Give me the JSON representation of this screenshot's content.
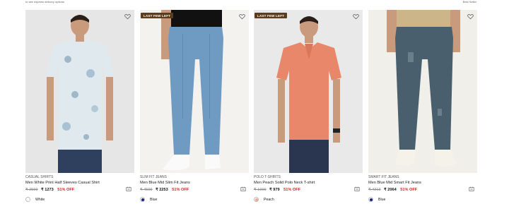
{
  "page": {
    "top_note": "to see express delivery options",
    "top_right": "Best Seller",
    "colors": {
      "discount": "#c62828",
      "badge": "#5a3d1e"
    }
  },
  "products": [
    {
      "badge": "",
      "category": "CASUAL SHIRTS",
      "name": "Men White Print Half Sleeves Casual Shirt",
      "mrp": "₹ 2599",
      "price": "₹ 1273",
      "discount": "51% OFF",
      "color_name": "White",
      "swatch": "#ffffff",
      "bg": "#e6e6e6",
      "top_color": "#dfe9ee",
      "bottom_color": "#2f3f5e"
    },
    {
      "badge": "LAST FEW LEFT",
      "category": "SLIM FIT JEANS",
      "name": "Men Blue Mid Slim Fit Jeans",
      "mrp": "₹ 4599",
      "price": "₹ 2253",
      "discount": "51% OFF",
      "color_name": "Blue",
      "swatch": "#1a237e",
      "bg": "#f3f2ef",
      "top_color": "#111111",
      "bottom_color": "#6f9ac2"
    },
    {
      "badge": "LAST FEW LEFT",
      "category": "POLO T-SHIRTS",
      "name": "Men Peach Solid Polo Neck T-shirt",
      "mrp": "₹ 1999",
      "price": "₹ 979",
      "discount": "51% OFF",
      "color_name": "Peach",
      "swatch": "#f4a98a",
      "bg": "#e9e9e9",
      "top_color": "#e8876a",
      "bottom_color": "#2a3550"
    },
    {
      "badge": "",
      "category": "SMART FIT JEANS",
      "name": "Men Blue Mid Smart Fit Jeans",
      "mrp": "₹ 4213",
      "price": "₹ 2064",
      "discount": "51% OFF",
      "color_name": "Blue",
      "swatch": "#1a237e",
      "bg": "#f1efea",
      "top_color": "#cdb58a",
      "bottom_color": "#4a5f6e"
    }
  ]
}
